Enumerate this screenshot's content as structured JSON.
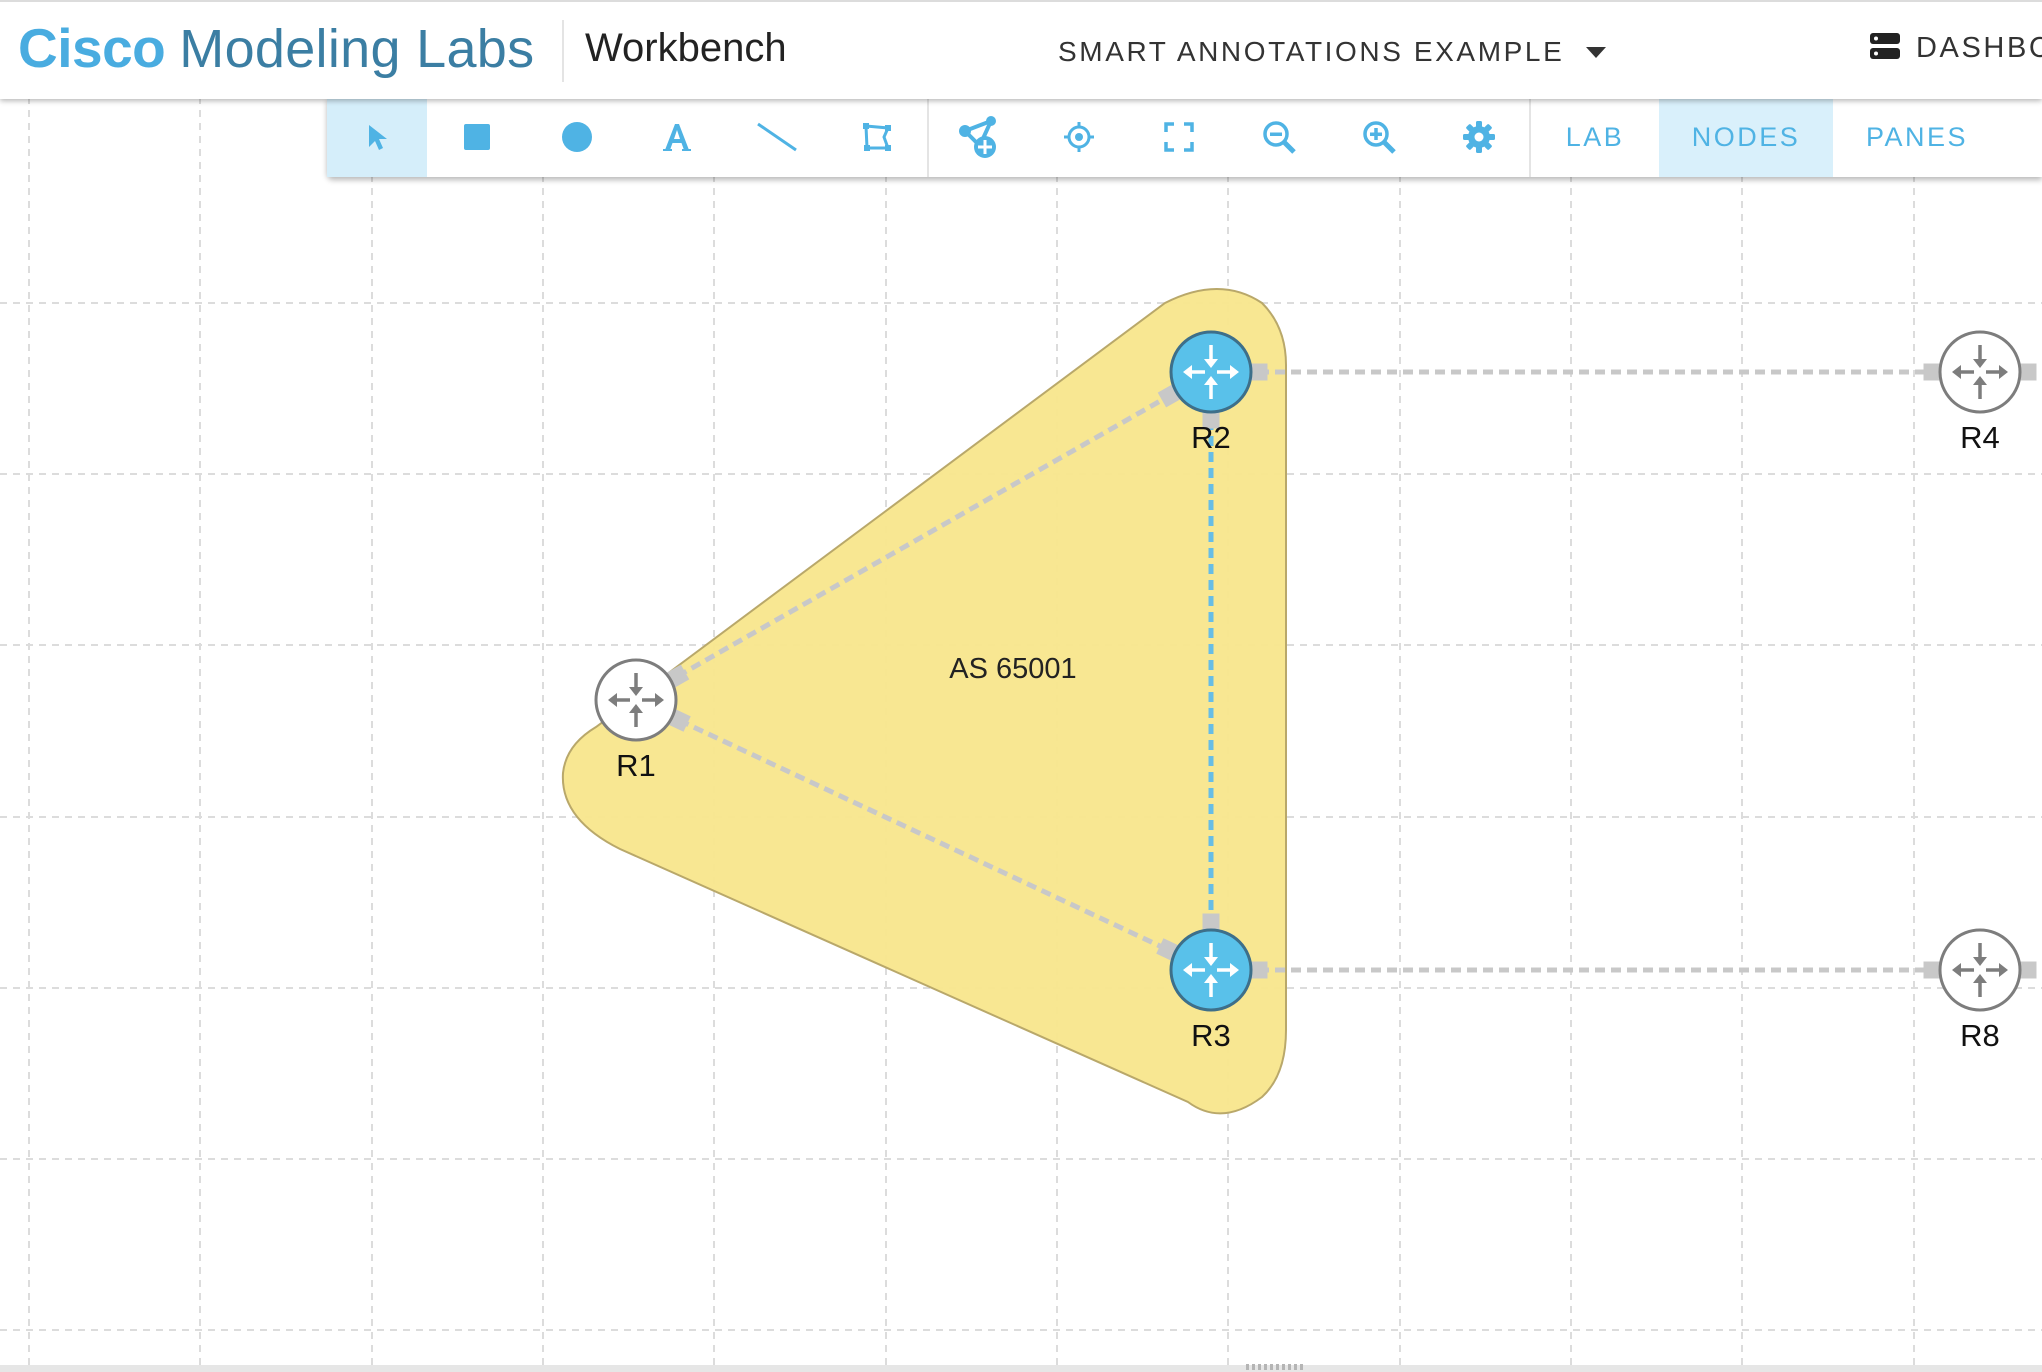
{
  "app": {
    "brand_strong": "Cisco",
    "brand_light": "Modeling Labs",
    "view_title": "Workbench",
    "lab_title": "SMART ANNOTATIONS EXAMPLE",
    "dashboard_label": "DASHBC"
  },
  "toolbar": {
    "tools": [
      {
        "id": "select",
        "icon": "pointer-icon",
        "active": true
      },
      {
        "id": "rectangle",
        "icon": "square-icon",
        "active": false
      },
      {
        "id": "ellipse",
        "icon": "circle-icon",
        "active": false
      },
      {
        "id": "text",
        "icon": "text-icon",
        "active": false
      },
      {
        "id": "line",
        "icon": "line-icon",
        "active": false
      },
      {
        "id": "polygon",
        "icon": "polygon-icon",
        "active": false
      }
    ],
    "actions": [
      {
        "id": "add-nodes",
        "icon": "add-node-icon"
      },
      {
        "id": "center",
        "icon": "crosshair-icon"
      },
      {
        "id": "fit",
        "icon": "fit-screen-icon"
      },
      {
        "id": "zoom-out",
        "icon": "zoom-out-icon"
      },
      {
        "id": "zoom-in",
        "icon": "zoom-in-icon"
      },
      {
        "id": "settings",
        "icon": "gear-icon"
      }
    ],
    "tabs": [
      {
        "label": "LAB",
        "active": false
      },
      {
        "label": "NODES",
        "active": true
      },
      {
        "label": "PANES",
        "active": false
      }
    ]
  },
  "topology": {
    "annotation": {
      "label": "AS 65001",
      "fill": "#f8e68c",
      "stroke": "#b9a86a"
    },
    "nodes": [
      {
        "id": "R1",
        "label": "R1",
        "state": "stopped"
      },
      {
        "id": "R2",
        "label": "R2",
        "state": "selected"
      },
      {
        "id": "R3",
        "label": "R3",
        "state": "selected"
      },
      {
        "id": "R4",
        "label": "R4",
        "state": "stopped"
      },
      {
        "id": "R8",
        "label": "R8",
        "state": "stopped"
      }
    ],
    "links": [
      {
        "from": "R1",
        "to": "R2",
        "selected": false
      },
      {
        "from": "R1",
        "to": "R3",
        "selected": false
      },
      {
        "from": "R2",
        "to": "R3",
        "selected": true
      },
      {
        "from": "R2",
        "to": "R4",
        "selected": false
      },
      {
        "from": "R3",
        "to": "R8",
        "selected": false
      }
    ]
  },
  "colors": {
    "accent": "#4fb3e4",
    "brand_blue": "#49ace0",
    "brand_dark": "#3b7ea3",
    "node_selected_fill": "#59c1ea",
    "node_stopped_fill": "#ffffff",
    "link": "#c8c8c8",
    "link_selected": "#67bde6",
    "grid": "#dcdcdc"
  }
}
